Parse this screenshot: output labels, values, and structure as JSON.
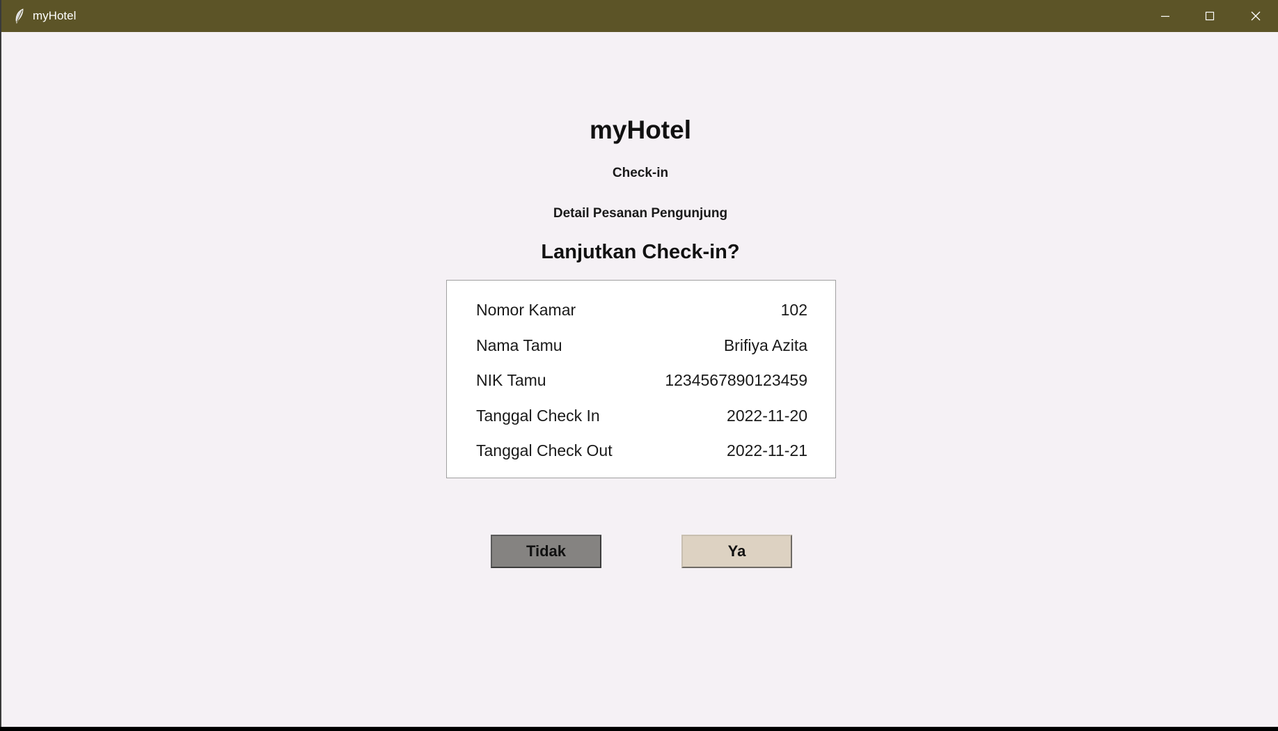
{
  "window": {
    "title": "myHotel",
    "titlebar_color": "#5c5427",
    "icons": [
      "feather-icon",
      "minimize-icon",
      "maximize-icon",
      "close-icon"
    ]
  },
  "header": {
    "app_name": "myHotel",
    "section": "Check-in",
    "subtitle": "Detail Pesanan Pengunjung",
    "question": "Lanjutkan Check-in?"
  },
  "details": [
    {
      "label": "Nomor Kamar",
      "value": "102"
    },
    {
      "label": "Nama Tamu",
      "value": "Brifiya Azita"
    },
    {
      "label": "NIK Tamu",
      "value": "1234567890123459"
    },
    {
      "label": "Tanggal Check In",
      "value": "2022-11-20"
    },
    {
      "label": "Tanggal Check Out",
      "value": "2022-11-21"
    }
  ],
  "actions": {
    "no_label": "Tidak",
    "yes_label": "Ya",
    "no_color": "#858381",
    "yes_color": "#ddd2c2"
  }
}
